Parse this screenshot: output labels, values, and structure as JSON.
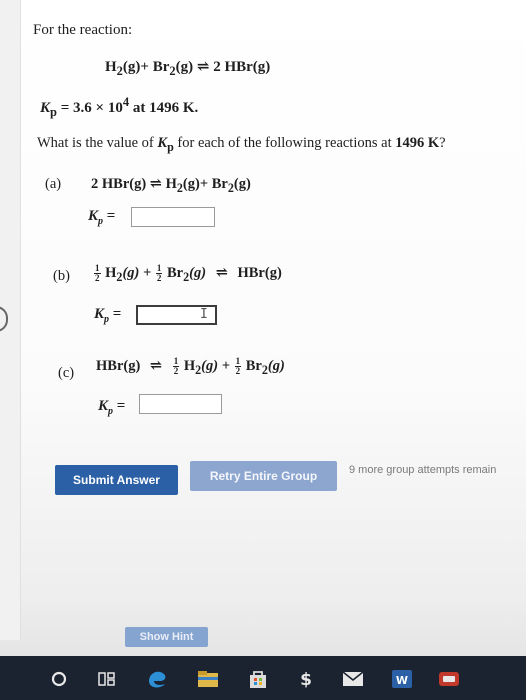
{
  "question": {
    "intro": "For the reaction:",
    "main_equation": {
      "left_1": "H",
      "left_1_sub": "2",
      "left_1_phase": "(g)+ Br",
      "left_2_sub": "2",
      "left_2_phase": "(g)",
      "arrow": "⇌",
      "right": "2 HBr(g)"
    },
    "given": {
      "k": "K",
      "k_sub": "p",
      "eq": "= 3.6 × 10",
      "exp": "4",
      "tail": "at 1496 K."
    },
    "ask_prefix": "What is the value of ",
    "ask_k": "K",
    "ask_k_sub": "p",
    "ask_mid": " for each of the following reactions at ",
    "ask_temp": "1496 K",
    "ask_end": "?"
  },
  "parts": {
    "a": {
      "label": "(a)",
      "left": "2 HBr(g)",
      "arrow": "⇌",
      "right_1": "H",
      "right_1_sub": "2",
      "right_1_phase": "(g)+ Br",
      "right_2_sub": "2",
      "right_2_phase": "(g)",
      "kp": "K",
      "kp_sub": "p",
      "kp_eq": "=",
      "value": ""
    },
    "b": {
      "label": "(b)",
      "frac_num": "1",
      "frac_den": "2",
      "h": "H",
      "h_sub": "2",
      "h_phase": "(g) +",
      "br": "Br",
      "br_sub": "2",
      "br_phase": "(g)",
      "arrow": "⇌",
      "right": "HBr(g)",
      "kp": "K",
      "kp_sub": "p",
      "kp_eq": "=",
      "value": ""
    },
    "c": {
      "label": "(c)",
      "left": "HBr(g)",
      "arrow": "⇌",
      "frac_num": "1",
      "frac_den": "2",
      "h": "H",
      "h_sub": "2",
      "h_phase": "(g) +",
      "br": "Br",
      "br_sub": "2",
      "br_phase": "(g)",
      "kp": "K",
      "kp_sub": "p",
      "kp_eq": "=",
      "value": ""
    }
  },
  "actions": {
    "submit": "Submit Answer",
    "retry": "Retry Entire Group",
    "attempts": "9 more group attempts remain",
    "hint": "Show Hint"
  },
  "taskbar": {
    "icons": [
      "cortana-circle-icon",
      "task-view-icon",
      "edge-icon",
      "file-explorer-icon",
      "store-icon",
      "dollar-app-icon",
      "mail-icon",
      "word-icon",
      "media-app-icon"
    ],
    "word_letter": "W"
  },
  "colors": {
    "submit": "#2b5fa6",
    "retry": "#8da6cf",
    "hint": "#85a4cf",
    "taskbar": "#1b2230"
  }
}
